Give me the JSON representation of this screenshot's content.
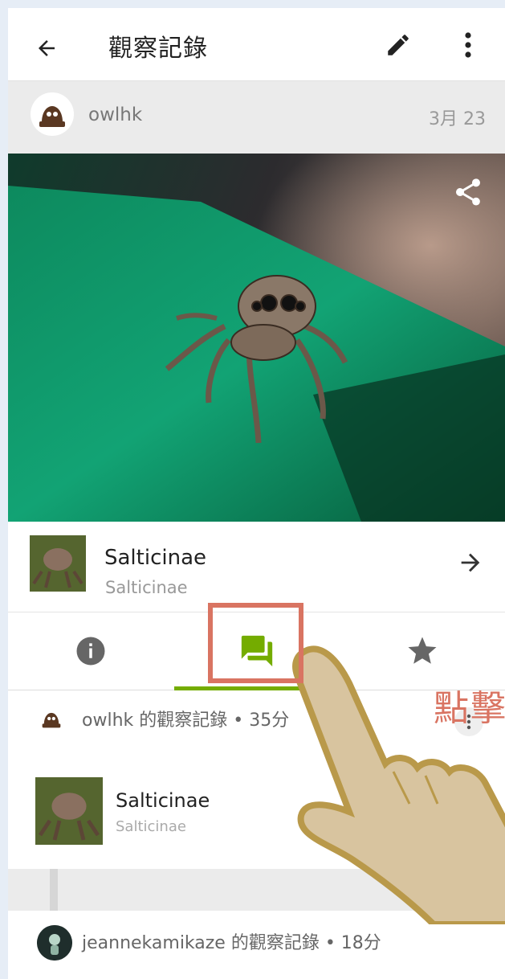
{
  "header": {
    "title": "觀察記錄"
  },
  "user": {
    "name": "owlhk",
    "date": "3月 23"
  },
  "taxon": {
    "common_name": "Salticinae",
    "scientific_name": "Salticinae"
  },
  "tabs": [
    {
      "id": "info",
      "icon": "info-icon"
    },
    {
      "id": "activity",
      "icon": "chat-bubbles-icon",
      "selected": true
    },
    {
      "id": "favorites",
      "icon": "star-icon"
    }
  ],
  "activity": {
    "header": "owlhk 的觀察記錄 • 35分",
    "identification": {
      "common_name": "Salticinae",
      "scientific_name": "Salticinae"
    }
  },
  "comment": {
    "header": "jeannekamikaze 的觀察記錄 • 18分"
  },
  "annotation": {
    "hint": "點擊"
  },
  "colors": {
    "accent": "#74ac00",
    "highlight": "#d97462"
  }
}
